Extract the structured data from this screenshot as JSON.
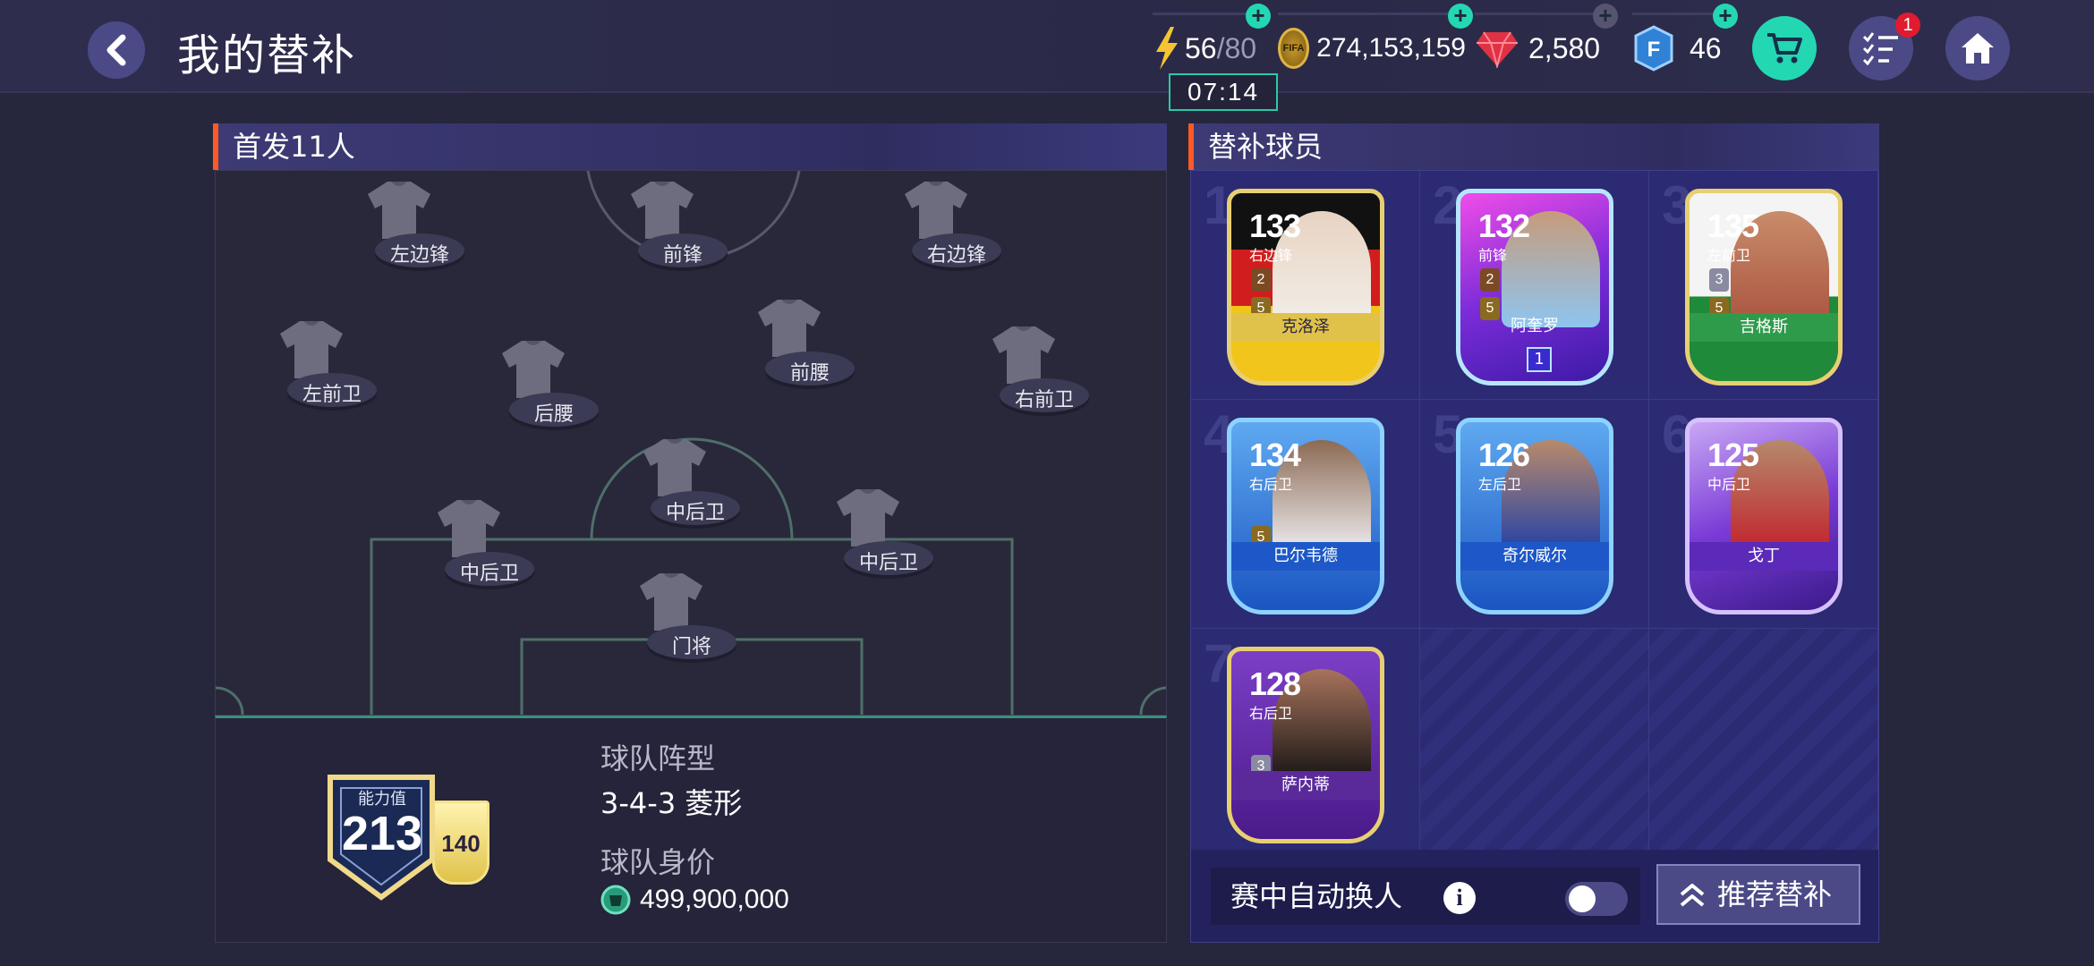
{
  "header": {
    "title": "我的替补",
    "energy": {
      "current": "56",
      "max": "/80",
      "timer": "07:14"
    },
    "coins": "274,153,159",
    "gems": "2,580",
    "fifa_points": "46",
    "notification_count": "1",
    "fifa_logo_text": "FIFA"
  },
  "starting": {
    "title": "首发11人",
    "positions": [
      {
        "label": "左边锋"
      },
      {
        "label": "前锋"
      },
      {
        "label": "右边锋"
      },
      {
        "label": "左前卫"
      },
      {
        "label": "后腰"
      },
      {
        "label": "前腰"
      },
      {
        "label": "右前卫"
      },
      {
        "label": "中后卫"
      },
      {
        "label": "中后卫"
      },
      {
        "label": "中后卫"
      },
      {
        "label": "门将"
      }
    ],
    "rating_label": "能力值",
    "rating_value": "213",
    "rating_side": "140",
    "formation_label": "球队阵型",
    "formation_value": "3-4-3 菱形",
    "value_label": "球队身价",
    "value_amount": "499,900,000"
  },
  "subs": {
    "title": "替补球员",
    "players": [
      {
        "index": "1",
        "rating": "133",
        "position": "右边锋",
        "name": "克洛泽",
        "chips": [
          "2",
          "5"
        ],
        "theme": "#e0c24a"
      },
      {
        "index": "2",
        "rating": "132",
        "position": "前锋",
        "name": "阿奎罗",
        "chips": [
          "2",
          "5"
        ],
        "theme": "#c23fd8",
        "rank": "1"
      },
      {
        "index": "3",
        "rating": "135",
        "position": "左前卫",
        "name": "吉格斯",
        "chips": [
          "3",
          "5"
        ],
        "theme": "#2e9b4a"
      },
      {
        "index": "4",
        "rating": "134",
        "position": "右后卫",
        "name": "巴尔韦德",
        "chips": [
          "5"
        ],
        "theme": "#2c6fd6"
      },
      {
        "index": "5",
        "rating": "126",
        "position": "左后卫",
        "name": "奇尔威尔",
        "chips": [],
        "theme": "#2c6fd6"
      },
      {
        "index": "6",
        "rating": "125",
        "position": "中后卫",
        "name": "戈丁",
        "chips": [],
        "theme": "#8a4fd8"
      },
      {
        "index": "7",
        "rating": "128",
        "position": "右后卫",
        "name": "萨内蒂",
        "chips": [
          "3"
        ],
        "theme": "#6a2aa8"
      }
    ],
    "auto_sub_label": "赛中自动换人",
    "auto_sub_on": false,
    "recommend_label": "推荐替补"
  }
}
